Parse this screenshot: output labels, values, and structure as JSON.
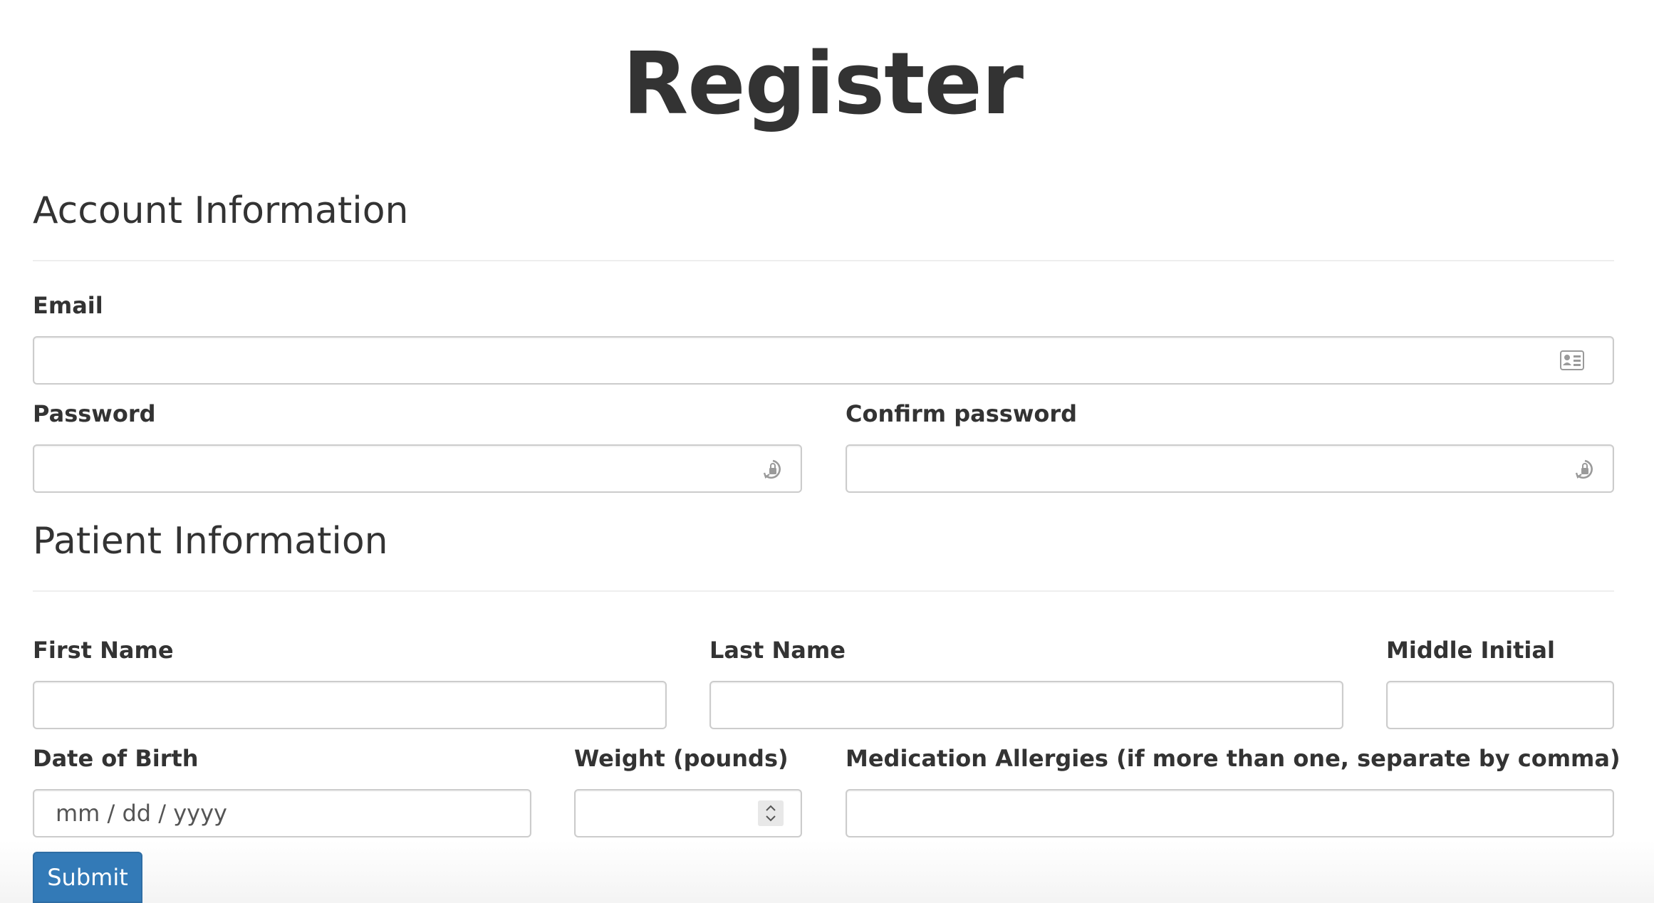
{
  "page": {
    "title": "Register"
  },
  "account_section": {
    "heading": "Account Information",
    "email_label": "Email",
    "email_value": "",
    "email_icon": "contact-card-icon",
    "password_label": "Password",
    "password_value": "",
    "password_icon": "password-manager-key-icon",
    "confirm_password_label": "Confirm password",
    "confirm_password_value": "",
    "confirm_password_icon": "password-manager-key-icon"
  },
  "patient_section": {
    "heading": "Patient Information",
    "first_name_label": "First Name",
    "first_name_value": "",
    "last_name_label": "Last Name",
    "last_name_value": "",
    "middle_initial_label": "Middle Initial",
    "middle_initial_value": "",
    "dob_label": "Date of Birth",
    "dob_placeholder": "mm / dd / yyyy",
    "weight_label": "Weight (pounds)",
    "weight_value": "",
    "allergies_label": "Medication Allergies (if more than one, separate by comma)",
    "allergies_value": ""
  },
  "actions": {
    "submit_label": "Submit",
    "submit_color": "#337ab7"
  },
  "colors": {
    "text": "#333333",
    "input_border": "#cccccc",
    "divider": "#eeeeee"
  }
}
